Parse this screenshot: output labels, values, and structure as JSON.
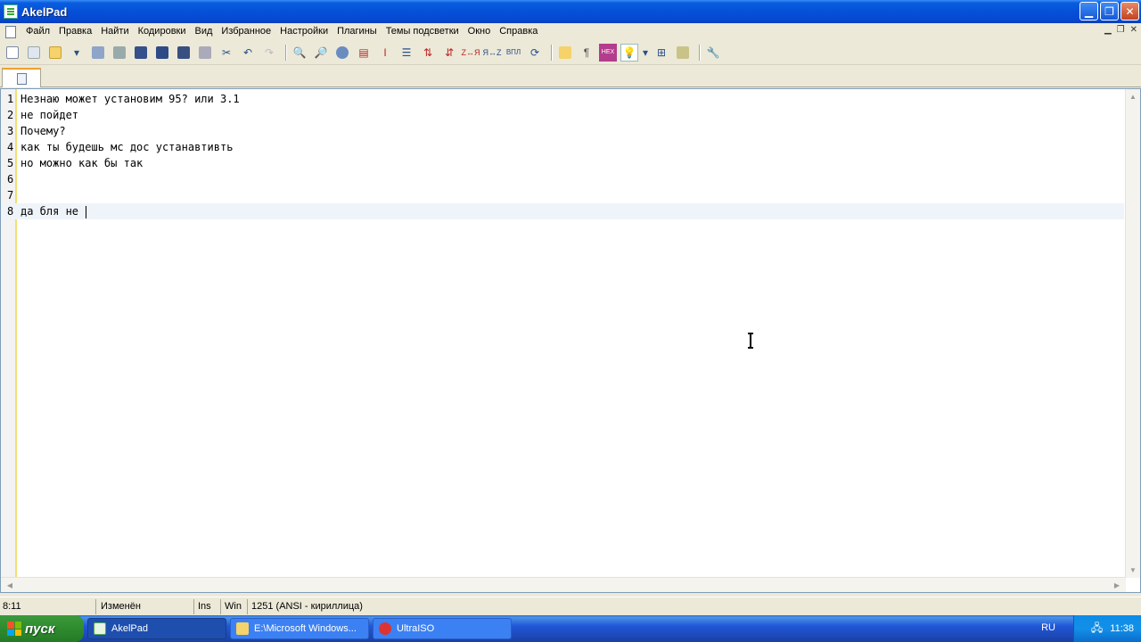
{
  "window": {
    "title": "AkelPad"
  },
  "menu": [
    "Файл",
    "Правка",
    "Найти",
    "Кодировки",
    "Вид",
    "Избранное",
    "Настройки",
    "Плагины",
    "Темы подсветки",
    "Окно",
    "Справка"
  ],
  "toolbar": {
    "icons": [
      "new-file-icon",
      "copy-icon",
      "open-folder-icon",
      "recent-files-icon",
      "save-icon",
      "save-all-icon",
      "save-as-icon",
      "print-icon",
      "cut-icon",
      "undo-icon",
      "redo-icon",
      "find-icon",
      "replace-icon",
      "goto-icon",
      "insert-icon",
      "list-icon",
      "sort-asc-icon",
      "sort-desc-icon",
      "case-icon",
      "case-swap-icon",
      "encoding-icon",
      "wrap-icon",
      "open-dir-icon",
      "pilcrow-icon",
      "hex-icon",
      "bulb-icon",
      "split-icon",
      "clipboard-icon",
      "settings-icon"
    ]
  },
  "editor": {
    "lines": [
      {
        "num": "1",
        "text": "Незнаю может установим 95? или 3.1"
      },
      {
        "num": "2",
        "text": "не пойдет"
      },
      {
        "num": "3",
        "text": "Почему?"
      },
      {
        "num": "4",
        "text": "как ты будешь мс дос устанавтивть"
      },
      {
        "num": "5",
        "text": "но можно как бы так"
      },
      {
        "num": "6",
        "text": ""
      },
      {
        "num": "7",
        "text": ""
      },
      {
        "num": "8",
        "text": "да бля не "
      }
    ],
    "current_line": 8
  },
  "status": {
    "position": "8:11",
    "modified": "Изменён",
    "insert_mode": "Ins",
    "newline": "Win",
    "codepage": "1251  (ANSI - кириллица)"
  },
  "taskbar": {
    "start_label": "пуск",
    "tasks": [
      {
        "label": "AkelPad",
        "active": true
      },
      {
        "label": "E:\\Microsoft Windows...",
        "active": false
      },
      {
        "label": "UltraISO",
        "active": false
      }
    ],
    "language": "RU",
    "clock": "11:38"
  },
  "colors": {
    "title_bar": "#0550d8",
    "taskbar": "#2157d7",
    "start_button": "#2e8b2e",
    "gutter_border": "#f0e070"
  }
}
